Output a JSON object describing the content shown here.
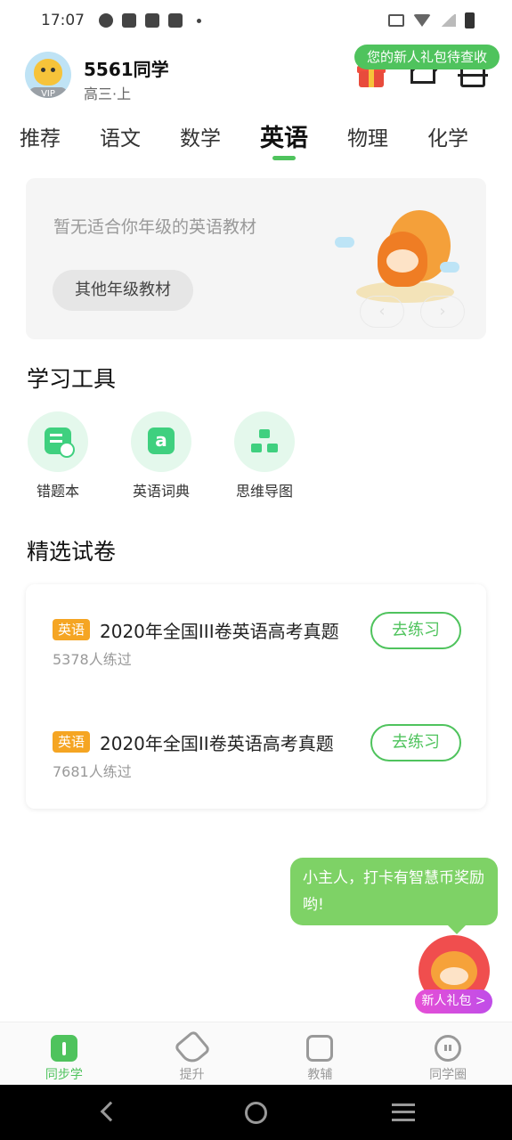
{
  "status_bar": {
    "time": "17:07"
  },
  "header": {
    "user_name": "5561同学",
    "grade": "高三·上",
    "vip_label": "VIP",
    "gift_tip": "您的新人礼包待查收"
  },
  "tabs": [
    {
      "label": "推荐",
      "active": false
    },
    {
      "label": "语文",
      "active": false
    },
    {
      "label": "数学",
      "active": false
    },
    {
      "label": "英语",
      "active": true
    },
    {
      "label": "物理",
      "active": false
    },
    {
      "label": "化学",
      "active": false
    }
  ],
  "textbook": {
    "empty_message": "暂无适合你年级的英语教材",
    "other_grade_button": "其他年级教材"
  },
  "tools": {
    "title": "学习工具",
    "items": [
      {
        "label": "错题本",
        "icon": "error-book-icon"
      },
      {
        "label": "英语词典",
        "icon": "dictionary-icon"
      },
      {
        "label": "思维导图",
        "icon": "mind-map-icon"
      }
    ]
  },
  "exams": {
    "title": "精选试卷",
    "items": [
      {
        "tag": "英语",
        "title": "2020年全国III卷英语高考真题",
        "count": "5378人练过",
        "button": "去练习"
      },
      {
        "tag": "英语",
        "title": "2020年全国II卷英语高考真题",
        "count": "7681人练过",
        "button": "去练习"
      }
    ]
  },
  "chat": {
    "message": "小主人，打卡有智慧币奖励哟!",
    "newbie_button": "新人礼包 >"
  },
  "bottom_nav": [
    {
      "label": "同步学",
      "icon": "sync-learn-icon",
      "active": true
    },
    {
      "label": "提升",
      "icon": "improve-tag-icon",
      "active": false
    },
    {
      "label": "教辅",
      "icon": "tutor-book-icon",
      "active": false
    },
    {
      "label": "同学圈",
      "icon": "classmates-face-icon",
      "active": false
    }
  ],
  "colors": {
    "accent": "#4fc35d",
    "tag": "#f5a523",
    "tool_bg": "#e4f8ec",
    "tool_icon": "#3fd07f",
    "chat_bubble": "#7ed266"
  }
}
